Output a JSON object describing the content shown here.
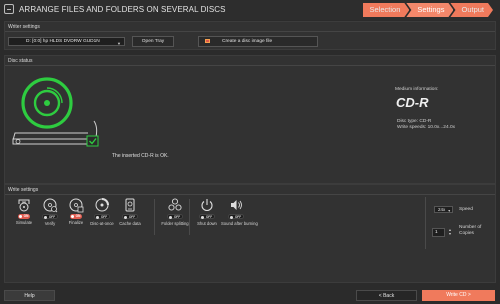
{
  "window": {
    "title": "ARRANGE FILES AND FOLDERS ON SEVERAL DISCS"
  },
  "steps": [
    {
      "label": "Selection",
      "active": false
    },
    {
      "label": "Settings",
      "active": true
    },
    {
      "label": "Output",
      "active": false
    }
  ],
  "writer_settings": {
    "title": "Writer settings",
    "drive": "D: [0:0] hp HLDS DVDRW  GUD1N",
    "open_tray": "Open Tray",
    "create_image": "Create a disc image file"
  },
  "disc_status": {
    "title": "Disc status",
    "message": "The inserted CD-R is OK.",
    "medium_title": "Medium information:",
    "medium_type": "CD-R",
    "disc_type": "Disc type: CD-R",
    "write_speeds": "Write speeds: 10.0x...24.0x",
    "ok_color": "#2ecc40"
  },
  "write_settings": {
    "title": "Write settings",
    "options": [
      {
        "label": "Simulate",
        "state": "ON",
        "icon": "simulate-icon"
      },
      {
        "label": "Verify",
        "state": "OFF",
        "icon": "verify-icon"
      },
      {
        "label": "Finalize",
        "state": "ON",
        "icon": "finalize-icon"
      },
      {
        "label": "Disc-at-once",
        "state": "OFF",
        "icon": "disc-at-once-icon"
      },
      {
        "label": "Cache data",
        "state": "OFF",
        "icon": "cache-data-icon"
      },
      {
        "label": "Folder splitting",
        "state": "OFF",
        "icon": "folder-splitting-icon"
      },
      {
        "label": "Shut down",
        "state": "OFF",
        "icon": "power-icon"
      },
      {
        "label": "Sound after burning",
        "state": "OFF",
        "icon": "speaker-icon"
      }
    ],
    "speed_value": "24x",
    "speed_label": "Speed",
    "copies_value": "1",
    "copies_label": "Number of Copies"
  },
  "bottom": {
    "help": "Help",
    "back": "< Back",
    "write": "Write CD >"
  },
  "colors": {
    "accent": "#f07a5c",
    "toggle_on": "#e05a4e",
    "background": "#2b2b2b"
  }
}
